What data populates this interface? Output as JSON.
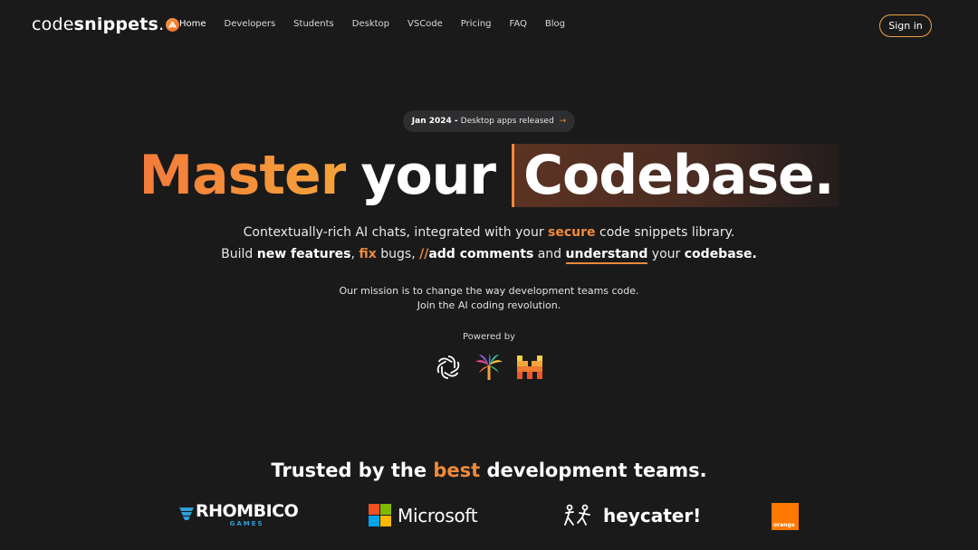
{
  "brand": {
    "name_light": "code",
    "name_bold": "snippets",
    "dot": ".",
    "accent": "#f08a3a"
  },
  "nav": {
    "items": [
      {
        "label": "Home",
        "active": true
      },
      {
        "label": "Developers"
      },
      {
        "label": "Students"
      },
      {
        "label": "Desktop"
      },
      {
        "label": "VSCode"
      },
      {
        "label": "Pricing"
      },
      {
        "label": "FAQ"
      },
      {
        "label": "Blog"
      }
    ],
    "signin_label": "Sign in"
  },
  "announcement": {
    "date": "Jan 2024 -",
    "text": "Desktop apps released",
    "arrow": "→"
  },
  "hero": {
    "word1": "Master",
    "word2": "your",
    "word3": "Codebase."
  },
  "subtitle": {
    "line1_a": "Contextually-rich AI chats, integrated with your ",
    "line1_b": "secure",
    "line1_c": " code snippets library.",
    "line2_a": "Build ",
    "line2_b": "new features",
    "line2_c": ", ",
    "line2_d": "fix",
    "line2_e": " bugs, ",
    "line2_f": "//",
    "line2_g": "add comments",
    "line2_h": " and ",
    "line2_i": "understand",
    "line2_j": " your ",
    "line2_k": "codebase."
  },
  "mission": {
    "line1": "Our mission is to change the way development teams code.",
    "line2": "Join the AI coding revolution."
  },
  "powered_by": {
    "label": "Powered by",
    "icons": [
      "openai-icon",
      "palm-tree-icon",
      "mistral-icon"
    ]
  },
  "trusted": {
    "a": "Trusted by the ",
    "b": "best",
    "c": " development teams."
  },
  "companies": [
    {
      "name": "RHOMBICO",
      "sub": "GAMES"
    },
    {
      "name": "Microsoft"
    },
    {
      "name": "heycater!"
    },
    {
      "name": "orange"
    }
  ]
}
